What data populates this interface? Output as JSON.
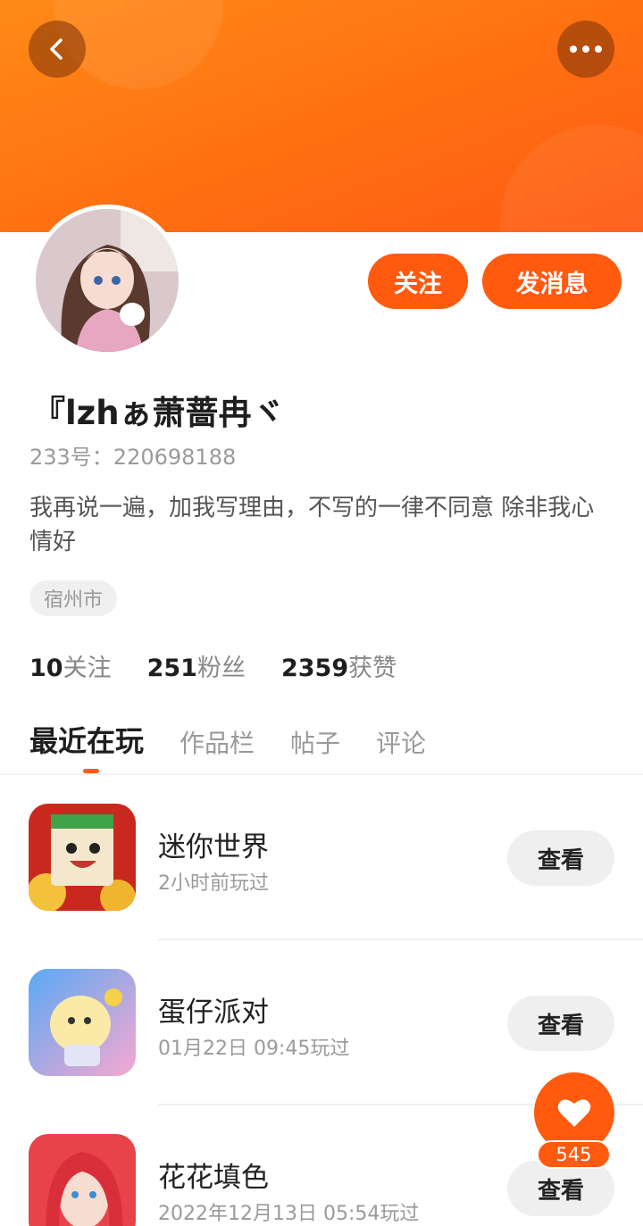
{
  "header": {
    "back_icon": "chevron-left-icon",
    "more_icon": "more-dots-icon",
    "banner_color": "#ff7412"
  },
  "profile": {
    "follow_label": "关注",
    "message_label": "发消息",
    "nickname": "『lzhぁ萧蔷冉ヾ",
    "id_text": "233号：220698188",
    "bio": "我再说一遍，加我写理由，不写的一律不同意   除非我心情好",
    "location": "宿州市"
  },
  "stats": [
    {
      "value": "10",
      "label": "关注"
    },
    {
      "value": "251",
      "label": "粉丝"
    },
    {
      "value": "2359",
      "label": "获赞"
    }
  ],
  "tabs": [
    {
      "label": "最近在玩",
      "active": true
    },
    {
      "label": "作品栏",
      "active": false
    },
    {
      "label": "帖子",
      "active": false
    },
    {
      "label": "评论",
      "active": false
    }
  ],
  "games": [
    {
      "title": "迷你世界",
      "subtitle": "2小时前玩过",
      "button": "查看"
    },
    {
      "title": "蛋仔派对",
      "subtitle": "01月22日 09:45玩过",
      "button": "查看"
    },
    {
      "title": "花花填色",
      "subtitle": "2022年12月13日 05:54玩过",
      "button": "查看"
    }
  ],
  "like_fab": {
    "icon": "heart-icon",
    "count": "545"
  },
  "accent_color": "#ff5a0e"
}
